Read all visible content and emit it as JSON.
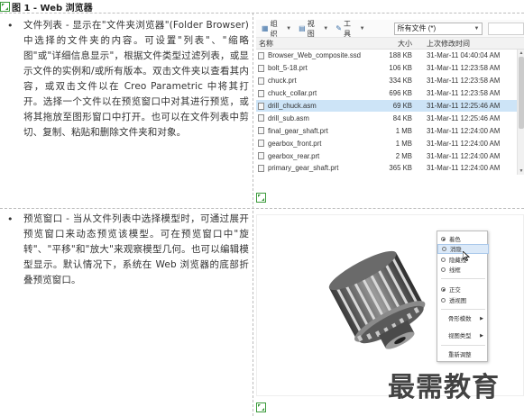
{
  "figure": {
    "title": "图 1 - Web 浏览器"
  },
  "section1": {
    "bullet": "•",
    "text": "文件列表 - 显示在\"文件夹浏览器\"(Folder Browser) 中选择的文件夹的内容。可设置\"列表\"、\"缩略图\"或\"详细信息显示\"，根据文件类型过滤列表，或显示文件的实例和/或所有版本。双击文件夹以查看其内容，或双击文件以在 Creo Parametric 中将其打开。选择一个文件以在预览窗口中对其进行预览，或将其拖放至图形窗口中打开。也可以在文件列表中剪切、复制、粘贴和删除文件夹和对象。"
  },
  "section2": {
    "bullet": "•",
    "text": "预览窗口 - 当从文件列表中选择模型时，可通过展开预览窗口来动态预览该模型。可在预览窗口中\"旋转\"、\"平移\"和\"放大\"来观察模型几何。也可以编辑模型显示。默认情况下，系统在 Web 浏览器的底部折叠预览窗口。"
  },
  "browser": {
    "toolbar": {
      "organize": "组织",
      "view": "视图",
      "tools": "工具",
      "filter": "所有文件 (*)"
    },
    "columns": {
      "name": "名称",
      "size": "大小",
      "date": "上次修改时间"
    },
    "files": [
      {
        "name": "Browser_Web_composite.ssd",
        "size": "188 KB",
        "date": "31-Mar-11 04:40:04 AM"
      },
      {
        "name": "bolt_5-18.prt",
        "size": "106 KB",
        "date": "31-Mar-11 12:23:58 AM"
      },
      {
        "name": "chuck.prt",
        "size": "334 KB",
        "date": "31-Mar-11 12:23:58 AM"
      },
      {
        "name": "chuck_collar.prt",
        "size": "696 KB",
        "date": "31-Mar-11 12:23:58 AM"
      },
      {
        "name": "drill_chuck.asm",
        "size": "69 KB",
        "date": "31-Mar-11 12:25:46 AM"
      },
      {
        "name": "drill_sub.asm",
        "size": "84 KB",
        "date": "31-Mar-11 12:25:46 AM"
      },
      {
        "name": "final_gear_shaft.prt",
        "size": "1 MB",
        "date": "31-Mar-11 12:24:00 AM"
      },
      {
        "name": "gearbox_front.prt",
        "size": "1 MB",
        "date": "31-Mar-11 12:24:00 AM"
      },
      {
        "name": "gearbox_rear.prt",
        "size": "2 MB",
        "date": "31-Mar-11 12:24:00 AM"
      },
      {
        "name": "primary_gear_shaft.prt",
        "size": "365 KB",
        "date": "31-Mar-11 12:24:00 AM"
      }
    ]
  },
  "preview_menu": {
    "items": [
      {
        "label": "着色",
        "kind": "radio",
        "checked": true
      },
      {
        "label": "消隐",
        "kind": "radio",
        "checked": false,
        "highlighted": true
      },
      {
        "label": "隐藏线",
        "kind": "radio",
        "checked": false
      },
      {
        "label": "线框",
        "kind": "radio",
        "checked": false
      },
      {
        "label": "正交",
        "kind": "radio",
        "checked": true
      },
      {
        "label": "透视图",
        "kind": "radio",
        "checked": false
      },
      {
        "label": "骨形模数",
        "kind": "submenu"
      },
      {
        "label": "视图类型",
        "kind": "submenu"
      },
      {
        "label": "重新调整",
        "kind": "plain"
      }
    ]
  },
  "watermark": "最需教育"
}
